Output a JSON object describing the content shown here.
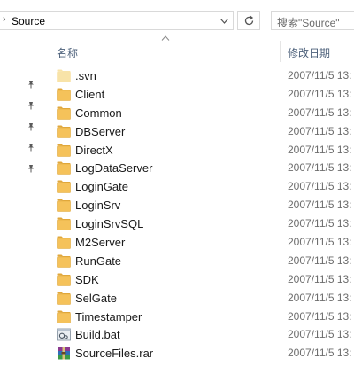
{
  "address_bar": {
    "path": "Source"
  },
  "search": {
    "placeholder": "搜索\"Source\""
  },
  "columns": {
    "name": "名称",
    "date_modified": "修改日期"
  },
  "files": [
    {
      "name": ".svn",
      "date": "2007/11/5 13:",
      "type": "folder-light"
    },
    {
      "name": "Client",
      "date": "2007/11/5 13:",
      "type": "folder"
    },
    {
      "name": "Common",
      "date": "2007/11/5 13:",
      "type": "folder"
    },
    {
      "name": "DBServer",
      "date": "2007/11/5 13:",
      "type": "folder"
    },
    {
      "name": "DirectX",
      "date": "2007/11/5 13:",
      "type": "folder"
    },
    {
      "name": "LogDataServer",
      "date": "2007/11/5 13:",
      "type": "folder"
    },
    {
      "name": "LoginGate",
      "date": "2007/11/5 13:",
      "type": "folder"
    },
    {
      "name": "LoginSrv",
      "date": "2007/11/5 13:",
      "type": "folder"
    },
    {
      "name": "LoginSrvSQL",
      "date": "2007/11/5 13:",
      "type": "folder"
    },
    {
      "name": "M2Server",
      "date": "2007/11/5 13:",
      "type": "folder"
    },
    {
      "name": "RunGate",
      "date": "2007/11/5 13:",
      "type": "folder"
    },
    {
      "name": "SDK",
      "date": "2007/11/5 13:",
      "type": "folder"
    },
    {
      "name": "SelGate",
      "date": "2007/11/5 13:",
      "type": "folder"
    },
    {
      "name": "Timestamper",
      "date": "2007/11/5 13:",
      "type": "folder"
    },
    {
      "name": "Build.bat",
      "date": "2007/11/5 13:",
      "type": "bat"
    },
    {
      "name": "SourceFiles.rar",
      "date": "2007/11/5 13:",
      "type": "rar"
    }
  ],
  "colors": {
    "folder": "#f5c25a",
    "folder_dark": "#e0a73a",
    "folder_light": "#f8e3a8",
    "header_text": "#4c607a"
  }
}
